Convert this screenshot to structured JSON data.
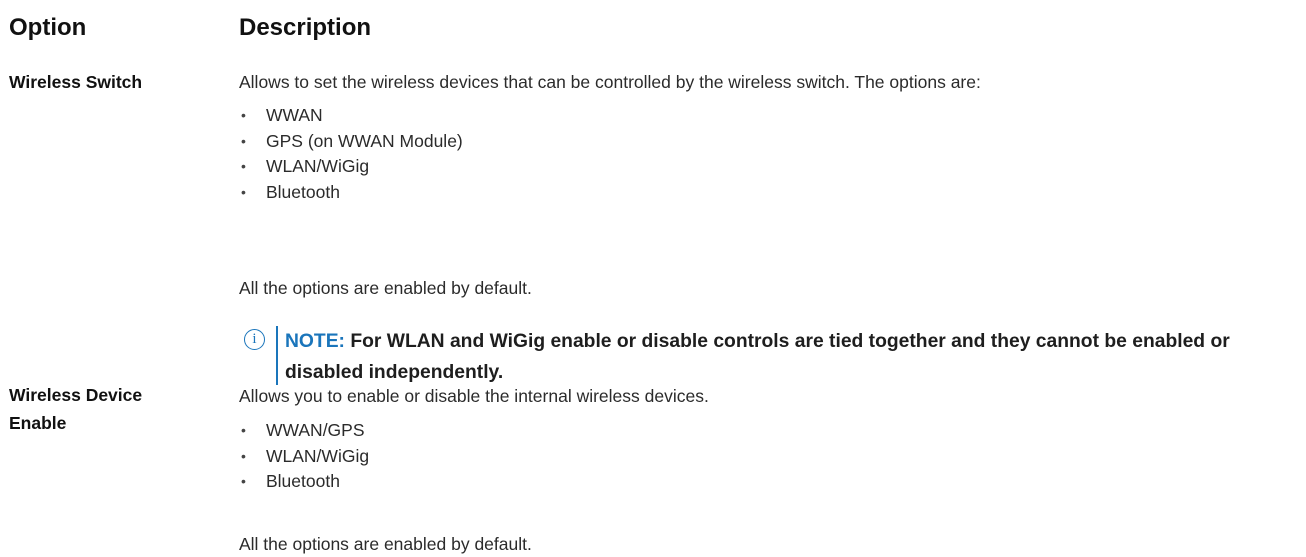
{
  "header": {
    "option": "Option",
    "description": "Description"
  },
  "rows": [
    {
      "option": "Wireless Switch",
      "description": "Allows to set the wireless devices that can be controlled by the wireless switch. The options are:",
      "items": [
        "WWAN",
        "GPS (on WWAN Module)",
        "WLAN/WiGig",
        "Bluetooth"
      ],
      "footer": "All the options are enabled by default.",
      "note": {
        "label": "NOTE:",
        "text": "For WLAN and WiGig enable or disable controls are tied together and they cannot be enabled or disabled independently."
      }
    },
    {
      "option_line1": "Wireless Device",
      "option_line2": "Enable",
      "description": "Allows you to enable or disable the internal wireless devices.",
      "items": [
        "WWAN/GPS",
        "WLAN/WiGig",
        "Bluetooth"
      ],
      "footer": "All the options are enabled by default."
    }
  ],
  "icons": {
    "note": "info-circle-icon",
    "bullet": "bullet-dot"
  },
  "colors": {
    "note_accent": "#1a75bb",
    "text": "#2b2b2b"
  }
}
